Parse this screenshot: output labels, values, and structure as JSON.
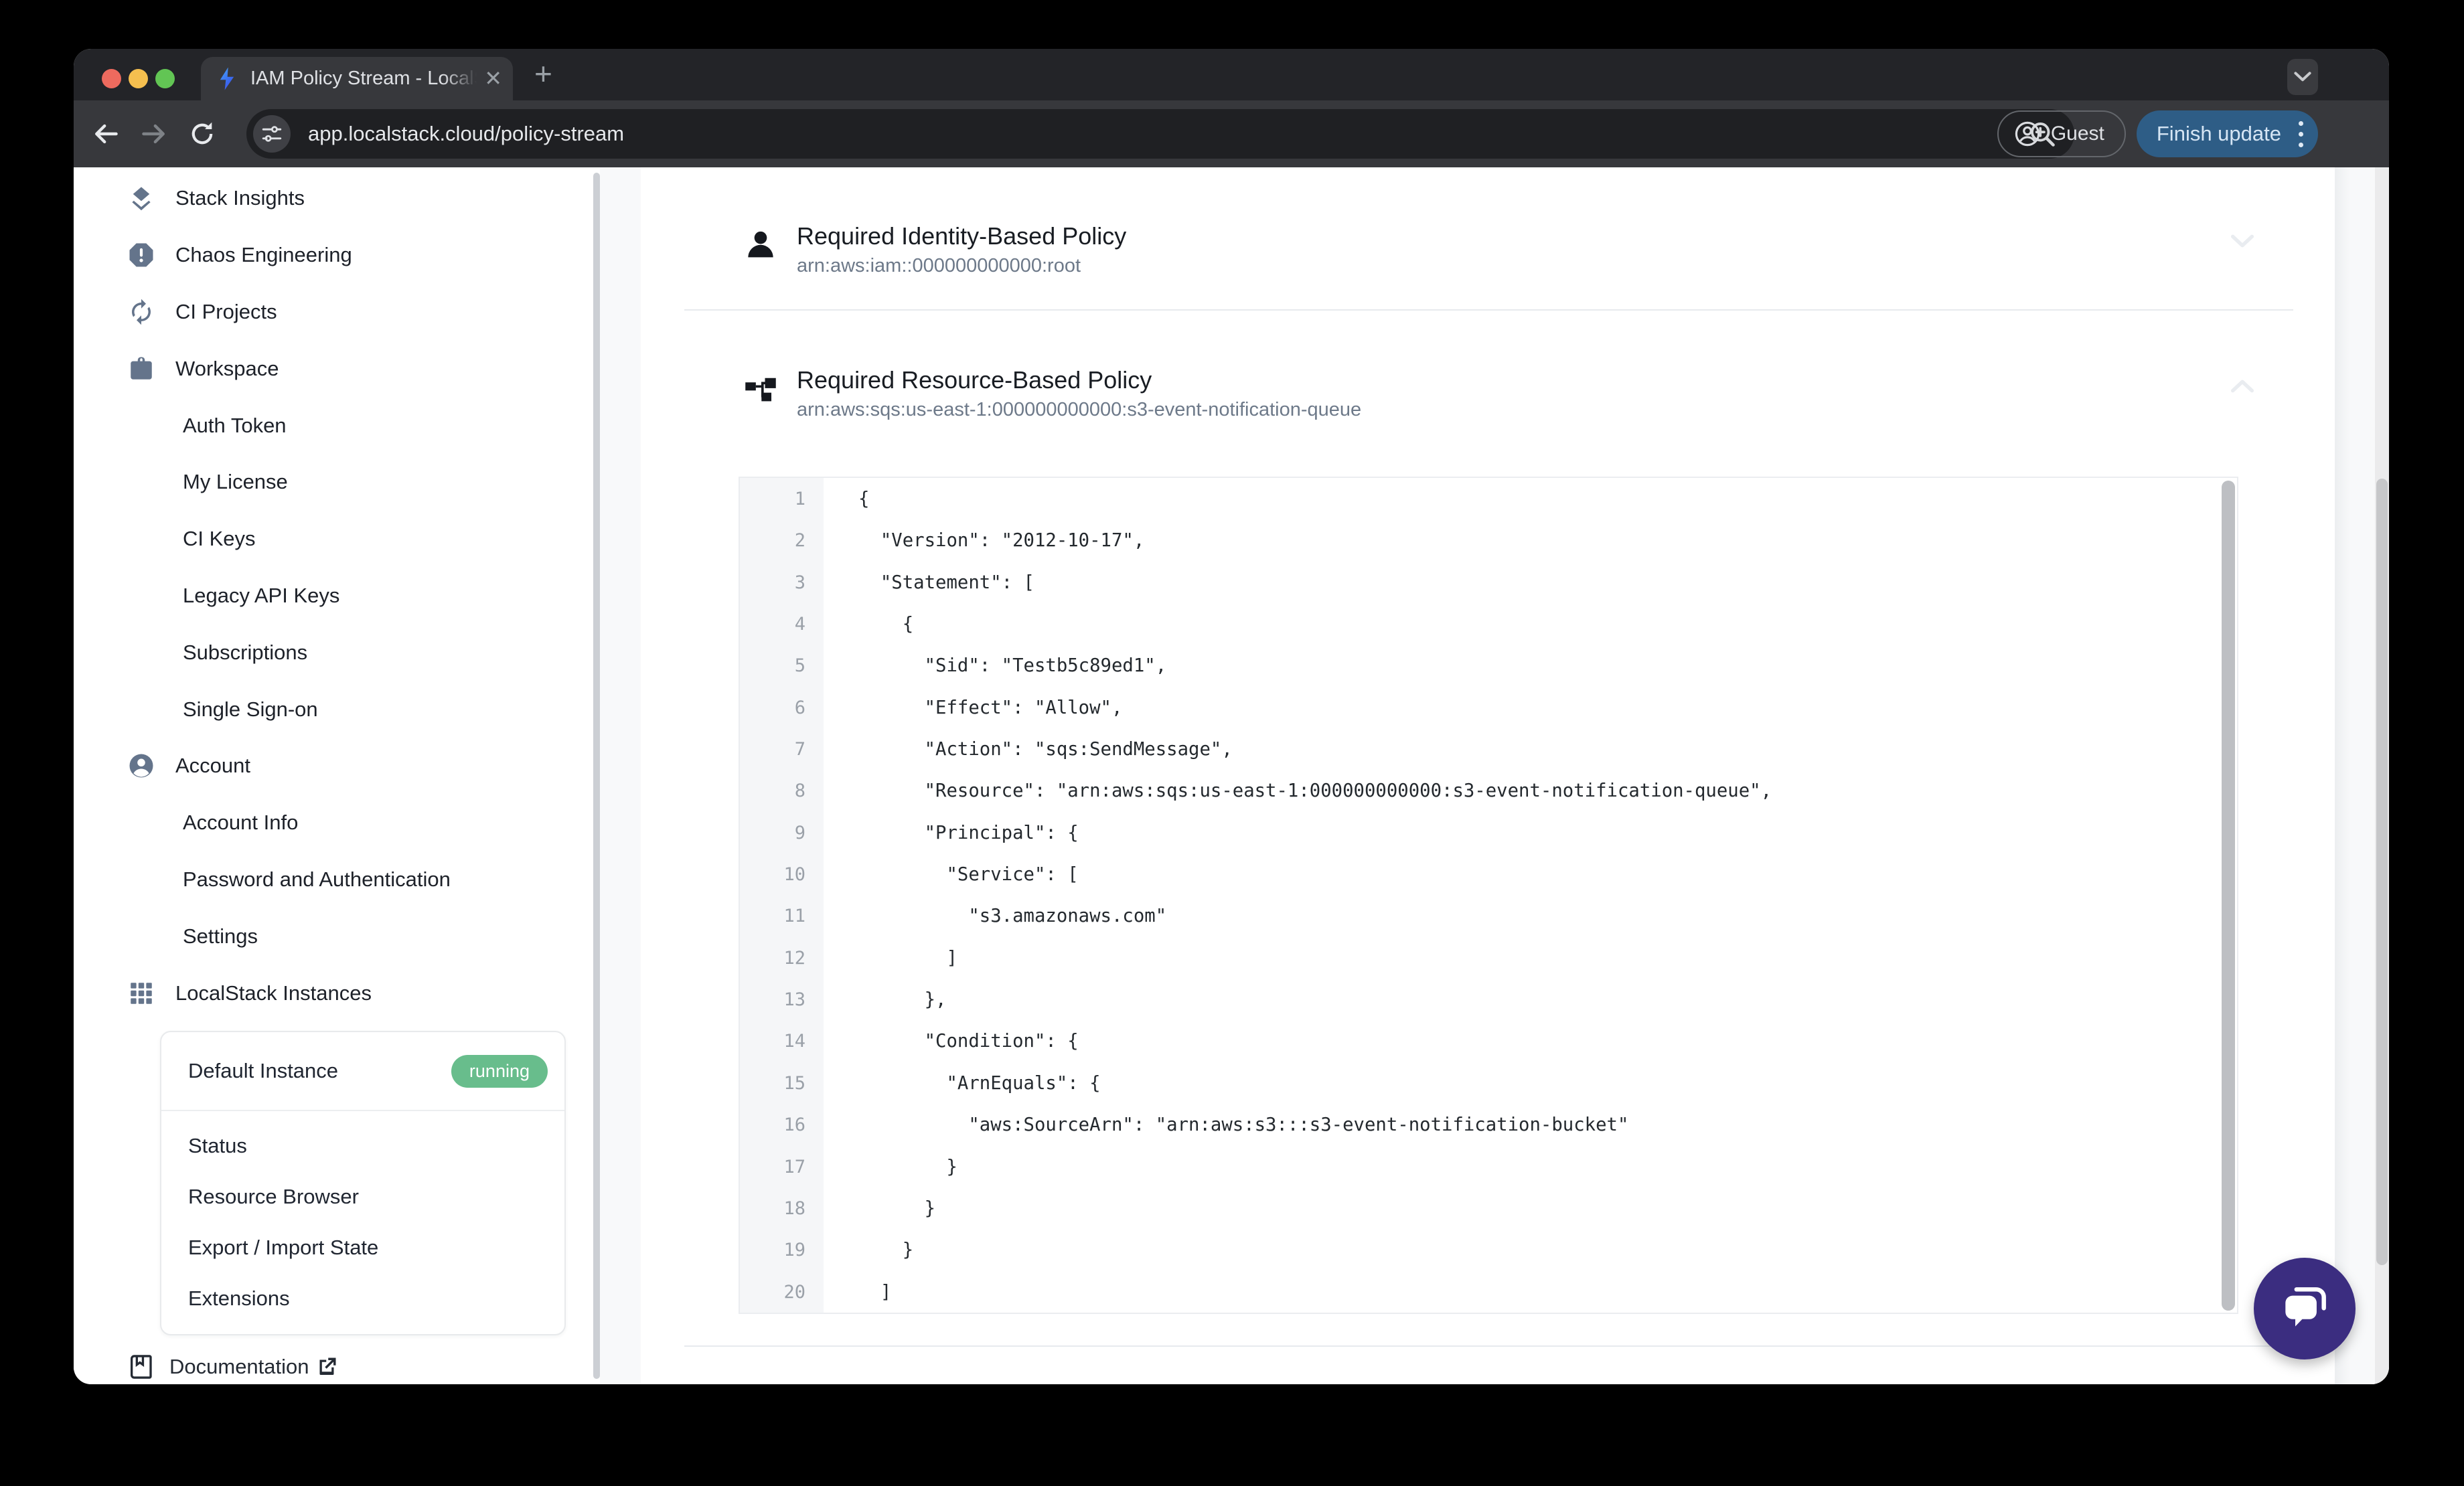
{
  "browser": {
    "tab": {
      "title": "IAM Policy Stream - LocalStack",
      "close_glyph": "✕",
      "new_tab_glyph": "+"
    },
    "toolbar": {
      "url": "app.localstack.cloud/policy-stream",
      "guest_label": "Guest",
      "finish_update_label": "Finish update"
    }
  },
  "sidebar": {
    "nav": [
      {
        "label": "Stack Insights",
        "icon": "layers"
      },
      {
        "label": "Chaos Engineering",
        "icon": "alert-octagon"
      },
      {
        "label": "CI Projects",
        "icon": "refresh"
      },
      {
        "label": "Workspace",
        "icon": "briefcase"
      },
      {
        "label": "Auth Token",
        "indent": true
      },
      {
        "label": "My License",
        "indent": true
      },
      {
        "label": "CI Keys",
        "indent": true
      },
      {
        "label": "Legacy API Keys",
        "indent": true
      },
      {
        "label": "Subscriptions",
        "indent": true
      },
      {
        "label": "Single Sign-on",
        "indent": true
      },
      {
        "label": "Account",
        "icon": "person-circle"
      },
      {
        "label": "Account Info",
        "indent": true
      },
      {
        "label": "Password and Authentication",
        "indent": true
      },
      {
        "label": "Settings",
        "indent": true
      },
      {
        "label": "LocalStack Instances",
        "icon": "grid"
      }
    ],
    "instance_card": {
      "title": "Default Instance",
      "status_badge": "running",
      "badge_color": "#68bd8c",
      "items": [
        "Status",
        "Resource Browser",
        "Export / Import State",
        "Extensions"
      ]
    },
    "documentation_label": "Documentation"
  },
  "main": {
    "sections": [
      {
        "title": "Required Identity-Based Policy",
        "arn": "arn:aws:iam::000000000000:root",
        "icon": "person",
        "chevron": "down"
      },
      {
        "title": "Required Resource-Based Policy",
        "arn": "arn:aws:sqs:us-east-1:000000000000:s3-event-notification-queue",
        "icon": "resource-tree",
        "chevron": "up"
      }
    ],
    "code": {
      "language": "json",
      "lines": [
        {
          "n": "1",
          "t": "{"
        },
        {
          "n": "2",
          "t": "  \"Version\": \"2012-10-17\","
        },
        {
          "n": "3",
          "t": "  \"Statement\": ["
        },
        {
          "n": "4",
          "t": "    {"
        },
        {
          "n": "5",
          "t": "      \"Sid\": \"Testb5c89ed1\","
        },
        {
          "n": "6",
          "t": "      \"Effect\": \"Allow\","
        },
        {
          "n": "7",
          "t": "      \"Action\": \"sqs:SendMessage\","
        },
        {
          "n": "8",
          "t": "      \"Resource\": \"arn:aws:sqs:us-east-1:000000000000:s3-event-notification-queue\","
        },
        {
          "n": "9",
          "t": "      \"Principal\": {"
        },
        {
          "n": "10",
          "t": "        \"Service\": ["
        },
        {
          "n": "11",
          "t": "          \"s3.amazonaws.com\""
        },
        {
          "n": "12",
          "t": "        ]"
        },
        {
          "n": "13",
          "t": "      },"
        },
        {
          "n": "14",
          "t": "      \"Condition\": {"
        },
        {
          "n": "15",
          "t": "        \"ArnEquals\": {"
        },
        {
          "n": "16",
          "t": "          \"aws:SourceArn\": \"arn:aws:s3:::s3-event-notification-bucket\""
        },
        {
          "n": "17",
          "t": "        }"
        },
        {
          "n": "18",
          "t": "      }"
        },
        {
          "n": "19",
          "t": "    }"
        },
        {
          "n": "20",
          "t": "  ]"
        }
      ]
    }
  }
}
